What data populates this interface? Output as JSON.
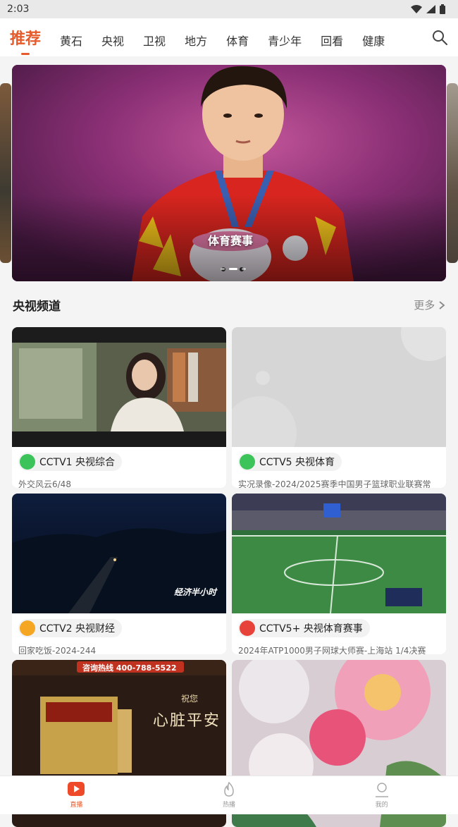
{
  "status": {
    "time": "2:03"
  },
  "tabs": [
    {
      "label": "推荐"
    },
    {
      "label": "黄石"
    },
    {
      "label": "央视"
    },
    {
      "label": "卫视"
    },
    {
      "label": "地方"
    },
    {
      "label": "体育"
    },
    {
      "label": "青少年"
    },
    {
      "label": "回看"
    },
    {
      "label": "健康"
    }
  ],
  "banner": {
    "caption": "体育赛事",
    "slides": 3,
    "active_slide": 1
  },
  "section": {
    "title": "央视频道",
    "more_label": "更多"
  },
  "cards": [
    {
      "channel": "CCTV1 央视综合",
      "program": "外交风云6/48",
      "logo_color": "#3cc45a"
    },
    {
      "channel": "CCTV5 央视体育",
      "program": "实况录像-2024/2025赛季中国男子篮球职业联赛常",
      "logo_color": "#3cc45a"
    },
    {
      "channel": "CCTV2 央视财经",
      "program": "回家吃饭-2024-244",
      "logo_color": "#f5a623"
    },
    {
      "channel": "CCTV5+ 央视体育赛事",
      "program": "2024年ATP1000男子网球大师赛-上海站 1/4决赛",
      "logo_color": "#e8433a"
    },
    {
      "hotline": "咨询热线 400-788-5522",
      "slogan_small": "祝您",
      "slogan_big": "心脏平安"
    }
  ],
  "thumb_labels": {
    "cctv2": "经济半小时"
  },
  "bottom_nav": [
    {
      "label": "直播",
      "active": true
    },
    {
      "label": "热播",
      "active": false
    },
    {
      "label": "我的",
      "active": false
    }
  ],
  "colors": {
    "accent": "#e65b2c"
  }
}
